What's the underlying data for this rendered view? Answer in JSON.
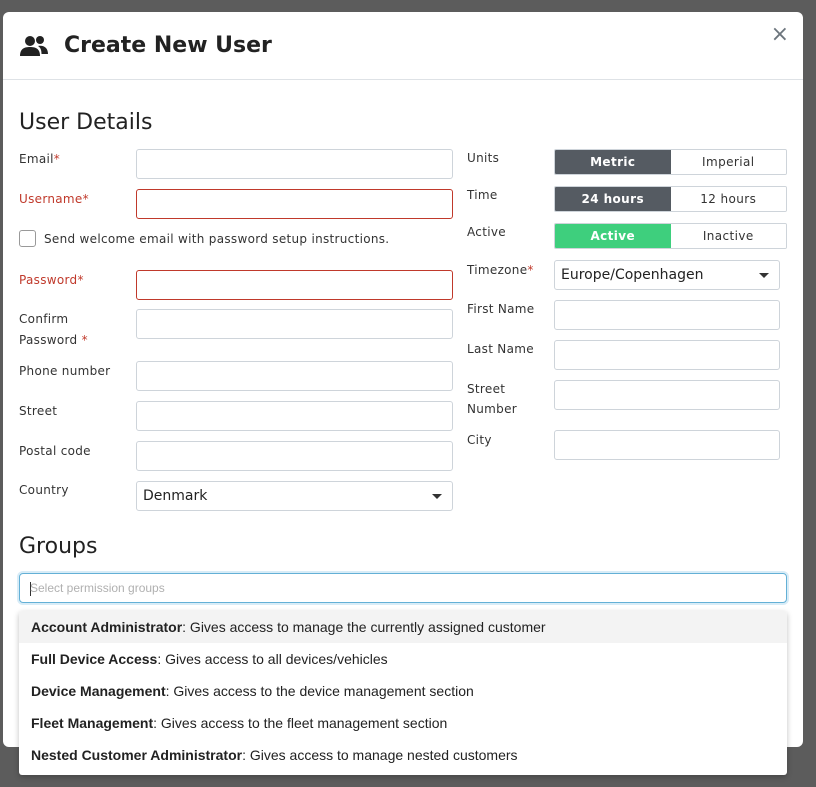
{
  "header": {
    "title": "Create New User",
    "close_label": "×"
  },
  "user_details": {
    "title": "User Details",
    "email_label": "Email",
    "username_label": "Username",
    "required_mark": "*",
    "welcome_email_label": "Send welcome email with password setup instructions.",
    "password_label": "Password",
    "confirm_label_1": "Confirm",
    "confirm_label_2": "Password",
    "phone_label": "Phone number",
    "street_label": "Street",
    "postal_label": "Postal code",
    "country_label": "Country",
    "country_value": "Denmark",
    "units_label": "Units",
    "units_options": [
      "Metric",
      "Imperial"
    ],
    "time_label": "Time",
    "time_options": [
      "24 hours",
      "12 hours"
    ],
    "active_label": "Active",
    "active_options": [
      "Active",
      "Inactive"
    ],
    "timezone_label": "Timezone",
    "timezone_value": "Europe/Copenhagen",
    "first_name_label": "First Name",
    "last_name_label": "Last Name",
    "street_number_label_1": "Street",
    "street_number_label_2": "Number",
    "city_label": "City"
  },
  "groups": {
    "title": "Groups",
    "placeholder": "Select permission groups",
    "options": [
      {
        "name": "Account Administrator",
        "desc": ": Gives access to manage the currently assigned customer"
      },
      {
        "name": "Full Device Access",
        "desc": ": Gives access to all devices/vehicles"
      },
      {
        "name": "Device Management",
        "desc": ": Gives access to the device management section"
      },
      {
        "name": "Fleet Management",
        "desc": ": Gives access to the fleet management section"
      },
      {
        "name": "Nested Customer Administrator",
        "desc": ": Gives access to manage nested customers"
      }
    ]
  },
  "colors": {
    "error": "#c0392b",
    "toggle_on": "#555b62",
    "active_on": "#3ecf7d",
    "focus": "#63b0d6"
  },
  "icons": {
    "header": "users-icon",
    "close": "close-icon",
    "select": "chevron-down-icon"
  }
}
